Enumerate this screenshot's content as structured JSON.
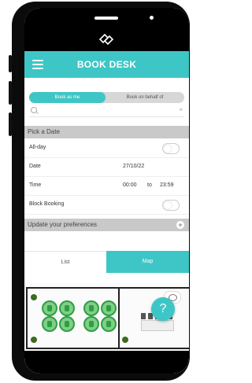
{
  "header": {
    "title": "BOOK DESK"
  },
  "booking_tabs": {
    "me": "Book as me",
    "behalf": "Book on behalf of"
  },
  "search": {
    "clear": "×"
  },
  "pick_date": {
    "title": "Pick a Date",
    "all_day": "All-day",
    "date_label": "Date",
    "date_value": "27/10/22",
    "time_label": "Time",
    "time_from": "00:00",
    "time_to_word": "to",
    "time_to": "23:59",
    "block_booking": "Block Booking"
  },
  "preferences": {
    "title": "Update your preferences",
    "plus": "+"
  },
  "view_tabs": {
    "list": "List",
    "map": "Map"
  },
  "fab": {
    "label": "?"
  },
  "colors": {
    "accent": "#3ec6c6",
    "section_bg": "#c9c9c9"
  }
}
